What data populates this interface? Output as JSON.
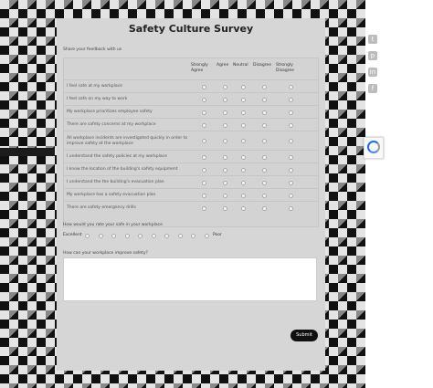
{
  "form": {
    "title": "Safety Culture Survey",
    "feedback_label": "Share your feedback with us",
    "columns": [
      "Strongly Agree",
      "Agree",
      "Neutral",
      "Disagree",
      "Strongly Disagree"
    ],
    "statements": [
      "I feel safe at my workplace",
      "I feel safe on my way to work",
      "My workplace prioritizes employee safety",
      "There are safety concerns at my workplace",
      "All workplace incidents are investigated quickly in order to improve safety at the workplace",
      "I understand the safety policies at my workplace",
      "I know the location of the building's safety equipment",
      "I understand the the building's evacuation plan",
      "My workplace has a safety evacuation plan",
      "There are safety emergency drills"
    ],
    "rating_question": "How would you rate your safe in your workplace",
    "rating_low": "Excellent",
    "rating_high": "Poor",
    "improve_question": "How can your workplace improve safety?",
    "improve_placeholder": "",
    "submit_label": "Submit"
  },
  "share_icons": [
    "twitter-icon",
    "pinterest-icon",
    "linkedin-icon",
    "facebook-icon"
  ],
  "share_glyphs": [
    "t",
    "p",
    "in",
    "f"
  ],
  "side_label": "",
  "colors": {
    "card_bg": "#d6d6d6",
    "submit_bg": "#111111",
    "title_text": "#222222"
  }
}
